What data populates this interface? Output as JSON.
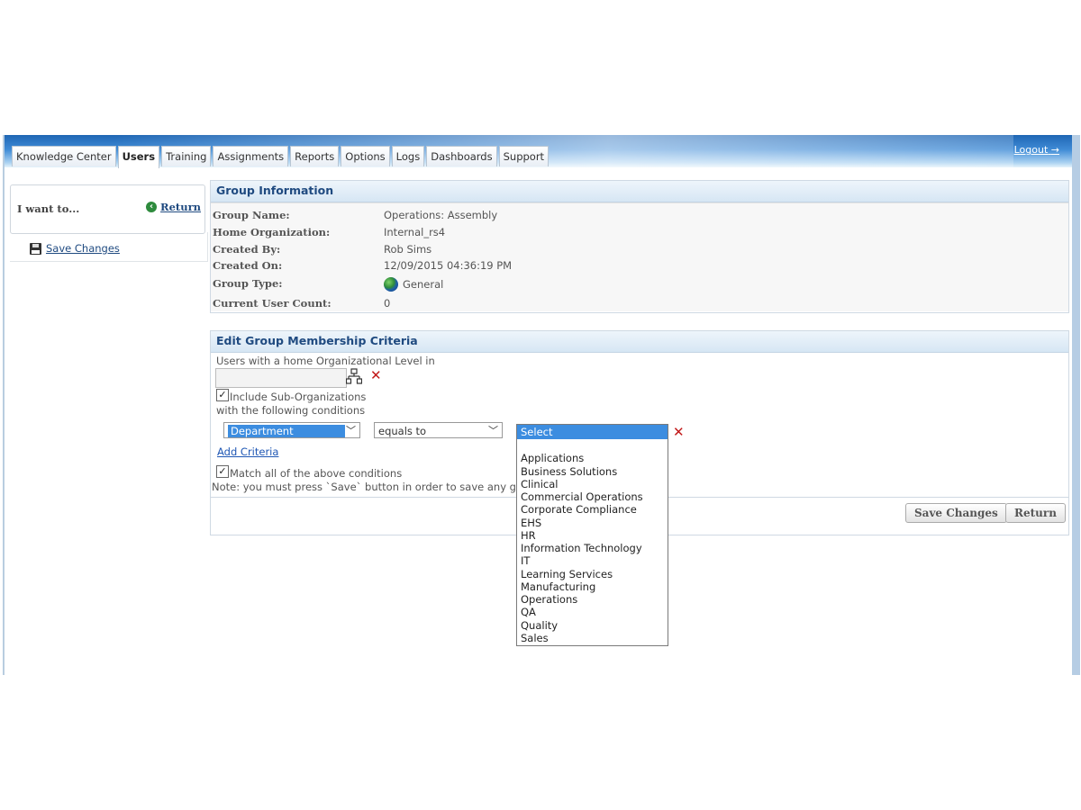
{
  "nav": {
    "tabs": [
      {
        "label": "Knowledge Center"
      },
      {
        "label": "Users"
      },
      {
        "label": "Training"
      },
      {
        "label": "Assignments"
      },
      {
        "label": "Reports"
      },
      {
        "label": "Options"
      },
      {
        "label": "Logs"
      },
      {
        "label": "Dashboards"
      },
      {
        "label": "Support"
      }
    ],
    "active_tab": "Users",
    "logout_label": "Logout"
  },
  "sidebar": {
    "i_want_label": "I want to...",
    "return_label": "Return",
    "save_changes_label": "Save Changes"
  },
  "group_info": {
    "title": "Group Information",
    "fields": [
      {
        "key": "Group Name:",
        "value": "Operations: Assembly"
      },
      {
        "key": "Home Organization:",
        "value": "Internal_rs4"
      },
      {
        "key": "Created By:",
        "value": "Rob Sims"
      },
      {
        "key": "Created On:",
        "value": "12/09/2015 04:36:19 PM"
      },
      {
        "key": "Group Type:",
        "value": "General"
      },
      {
        "key": "Current User Count:",
        "value": "0"
      }
    ]
  },
  "criteria": {
    "title": "Edit Group Membership Criteria",
    "org_level_label": "Users with a home Organizational Level in",
    "org_level_value": "",
    "include_sub_orgs_label": "Include Sub-Organizations",
    "include_sub_orgs_checked": true,
    "conditions_label": "with the following conditions",
    "field_select": "Department",
    "operator_select": "equals to",
    "value_select": "Select",
    "add_criteria_label": "Add Criteria",
    "match_all_label": "Match all of the above conditions",
    "match_all_checked": true,
    "note": "Note: you must press `Save` button in order to save any group",
    "save_button": "Save Changes",
    "return_button": "Return"
  },
  "value_dropdown": {
    "options": [
      "",
      "Applications",
      "Business Solutions",
      "Clinical",
      "Commercial Operations",
      "Corporate Compliance",
      "EHS",
      "HR",
      "Information Technology",
      "IT",
      "Learning Services",
      "Manufacturing",
      "Operations",
      "QA",
      "Quality",
      "Sales"
    ]
  },
  "colors": {
    "header_blue": "#2a72c2",
    "link_blue": "#1f4a80",
    "section_title": "#1f4a80",
    "highlight": "#3c8de0",
    "delete_red": "#c21a1a"
  }
}
